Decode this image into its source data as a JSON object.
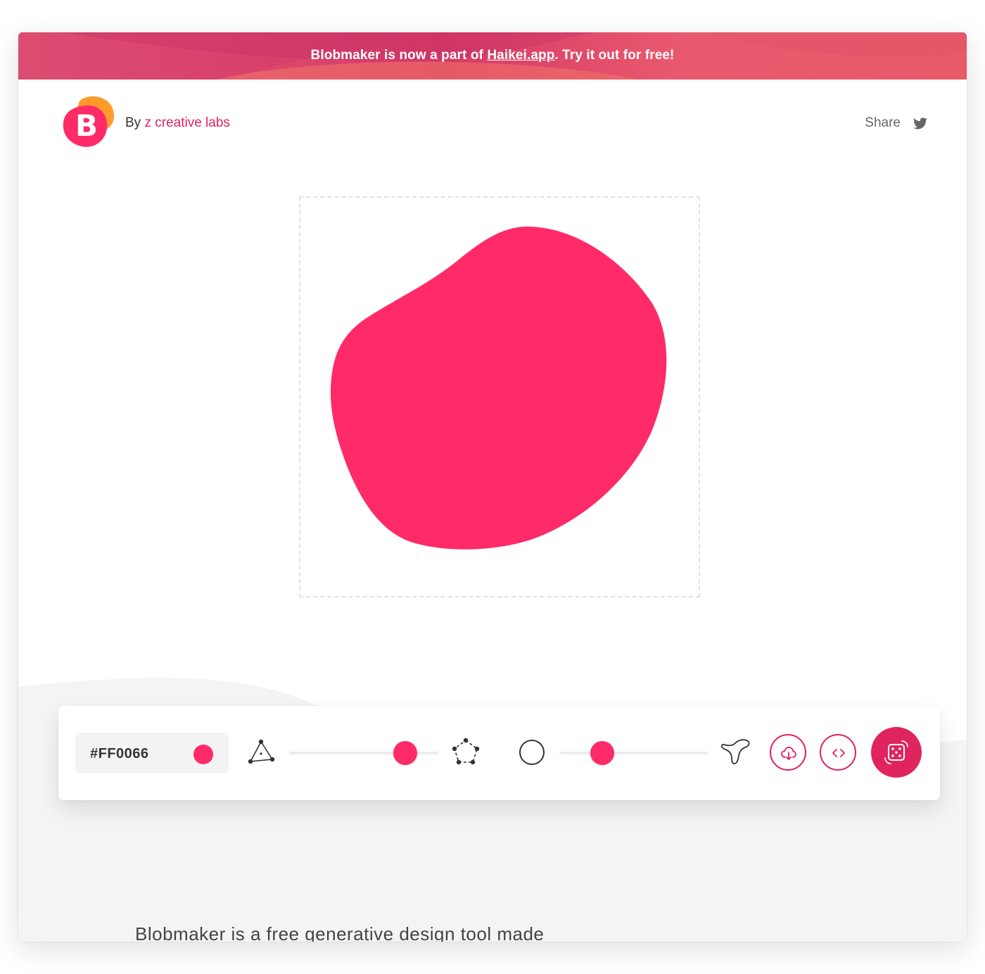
{
  "banner": {
    "text_before": "Blobmaker is now a part of ",
    "link_text": "Haikei.app",
    "text_after": ". Try it out for free!"
  },
  "header": {
    "logo_letter": "B",
    "by_label": "By",
    "brand_name": "z creative labs",
    "share_label": "Share"
  },
  "blob": {
    "fill_color": "#FF2A68"
  },
  "toolbar": {
    "color_value": "#FF0066",
    "complexity_level": 0.78,
    "contrast_level": 0.29
  },
  "description": {
    "text": "Blobmaker is a free generative design tool made"
  },
  "colors": {
    "accent": "#E21F60",
    "blob": "#FF2A68",
    "banner": "#D63A66"
  }
}
